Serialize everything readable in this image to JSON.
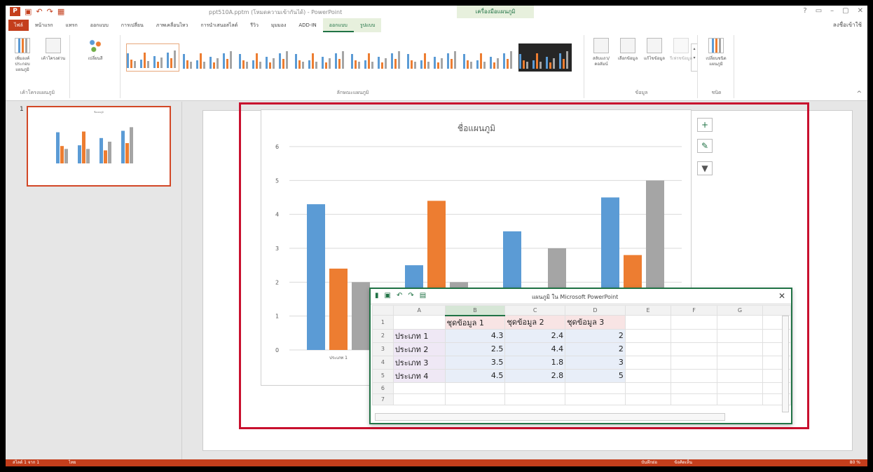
{
  "titlebar": {
    "app_icon": "powerpoint-icon",
    "document_title": "ppt510A.pptm (โหมดความเข้ากันได้) - PowerPoint",
    "context_group": "เครื่องมือแผนภูมิ",
    "window_controls": [
      "?",
      "▭",
      "–",
      "▢",
      "✕"
    ]
  },
  "tabs": {
    "file": "ไฟล์",
    "items": [
      "หน้าแรก",
      "แทรก",
      "ออกแบบ",
      "การเปลี่ยน",
      "ภาพเคลื่อนไหว",
      "การนำเสนอสไลด์",
      "รีวิว",
      "มุมมอง",
      "ADD-IN"
    ],
    "context_tabs": [
      "ออกแบบ",
      "รูปแบบ"
    ],
    "signin": "ลงชื่อเข้าใช้"
  },
  "ribbon": {
    "groups": [
      {
        "label": "เค้าโครงแผนภูมิ",
        "buttons": [
          "เพิ่มองค์ประกอบแผนภูมิ",
          "เค้าโครงด่วน"
        ]
      },
      {
        "label": "",
        "buttons": [
          "เปลี่ยนสี"
        ]
      },
      {
        "label": "ลักษณะแผนภูมิ",
        "buttons": []
      },
      {
        "label": "ข้อมูล",
        "buttons": [
          "สลับแถว/คอลัมน์",
          "เลือกข้อมูล",
          "แก้ไขข้อมูล",
          "รีเฟรชข้อมูล"
        ]
      },
      {
        "label": "ชนิด",
        "buttons": [
          "เปลี่ยนชนิดแผนภูมิ"
        ]
      }
    ]
  },
  "slide_panel": {
    "slide_number": "1"
  },
  "chart_data": {
    "type": "bar",
    "title": "ชื่อแผนภูมิ",
    "categories": [
      "ประเภท 1",
      "ประเภท 2",
      "ประเภท 3",
      "ประเภท 4"
    ],
    "series": [
      {
        "name": "ชุดข้อมูล 1",
        "values": [
          4.3,
          2.5,
          3.5,
          4.5
        ]
      },
      {
        "name": "ชุดข้อมูล 2",
        "values": [
          2.4,
          4.4,
          1.8,
          2.8
        ]
      },
      {
        "name": "ชุดข้อมูล 3",
        "values": [
          2,
          2,
          3,
          5
        ]
      }
    ],
    "colors": [
      "#5b9bd5",
      "#ed7d31",
      "#a5a5a5"
    ],
    "yticks": [
      "0",
      "1",
      "2",
      "3",
      "4",
      "5",
      "6"
    ],
    "ylim": [
      0,
      6
    ],
    "grid": true
  },
  "chart_side_buttons": {
    "elements": "+",
    "styles": "✎",
    "filters": "▼"
  },
  "sheet": {
    "title": "แผนภูมิ ใน Microsoft PowerPoint",
    "close": "✕",
    "columns": [
      "",
      "A",
      "B",
      "C",
      "D",
      "E",
      "F",
      "G",
      ""
    ],
    "row_numbers": [
      "1",
      "2",
      "3",
      "4",
      "5",
      "6",
      "7"
    ],
    "rows": [
      [
        "",
        "ชุดข้อมูล 1",
        "ชุดข้อมูล 2",
        "ชุดข้อมูล 3"
      ],
      [
        "ประเภท 1",
        "4.3",
        "2.4",
        "2"
      ],
      [
        "ประเภท 2",
        "2.5",
        "4.4",
        "2"
      ],
      [
        "ประเภท 3",
        "3.5",
        "1.8",
        "3"
      ],
      [
        "ประเภท 4",
        "4.5",
        "2.8",
        "5"
      ],
      [
        "",
        "",
        "",
        ""
      ],
      [
        "",
        "",
        "",
        ""
      ]
    ]
  },
  "statusbar": {
    "slide_info": "สไลด์ 1 จาก 1",
    "language": "ไทย",
    "notes": "บันทึกย่อ",
    "comments": "ข้อคิดเห็น",
    "zoom": "80 %"
  }
}
